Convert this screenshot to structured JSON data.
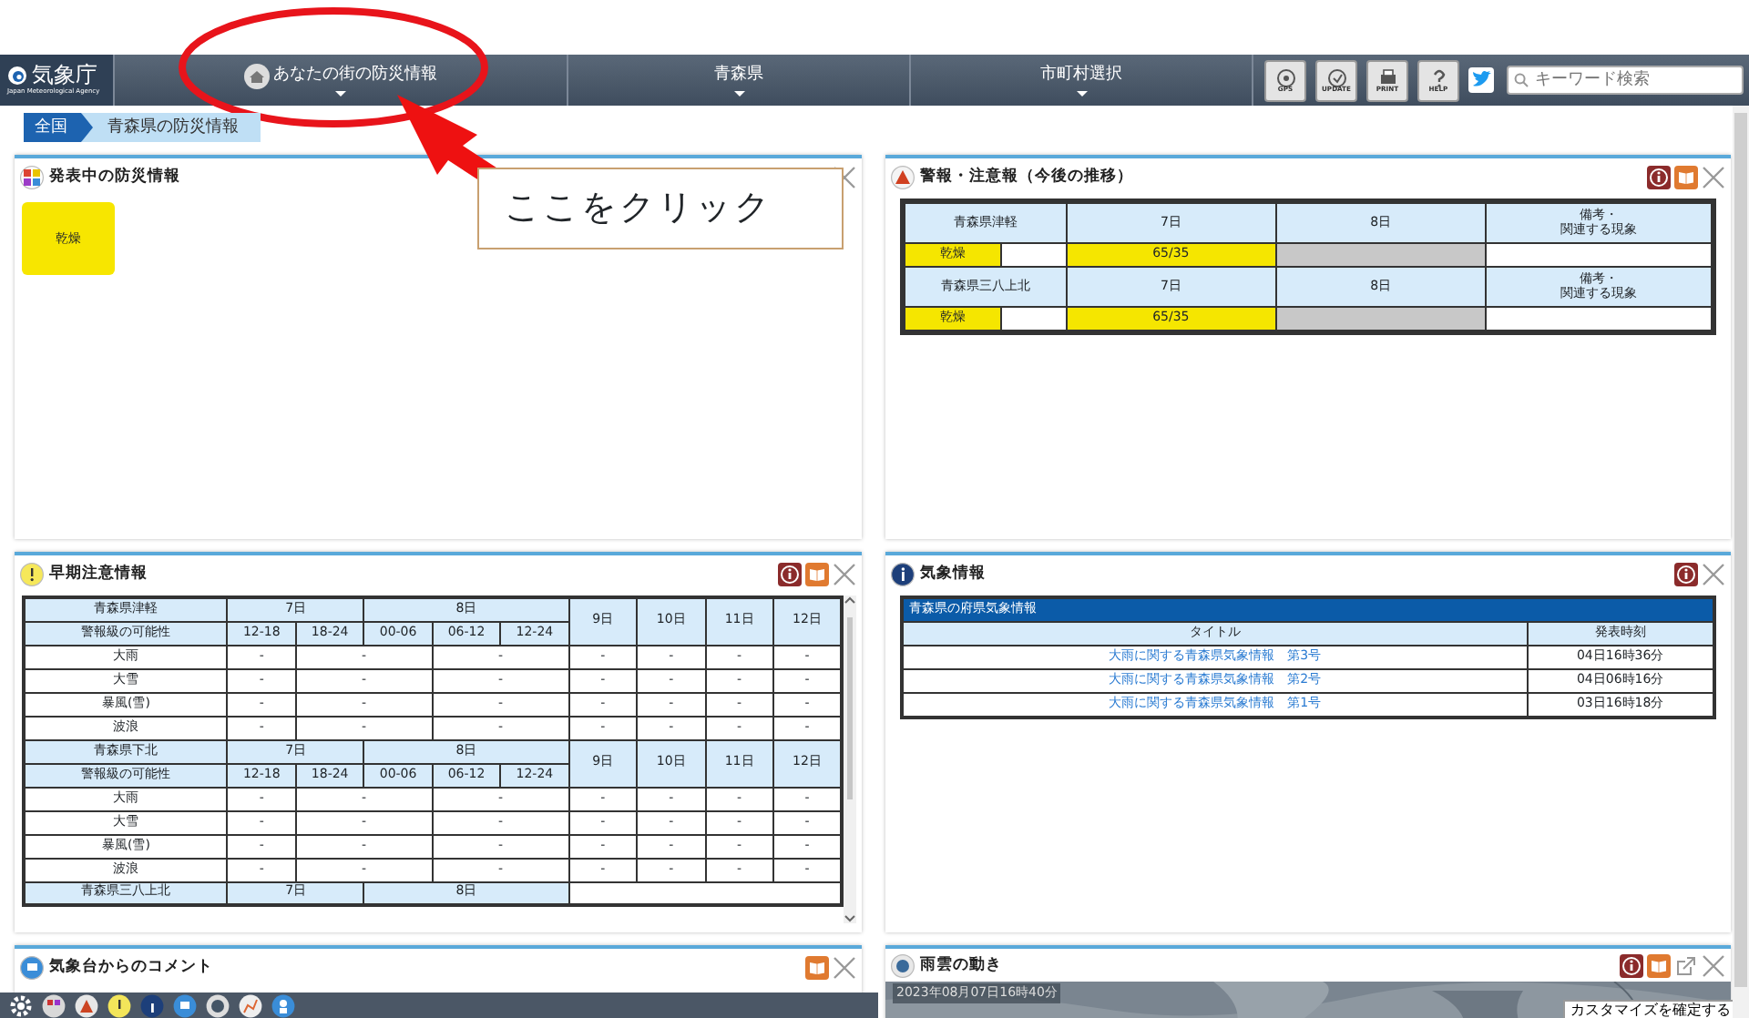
{
  "header": {
    "logo": {
      "name": "気象庁",
      "subtitle": "Japan Meteorological Agency"
    },
    "nav": [
      {
        "label": "あなたの街の防災情報",
        "kind": "home"
      },
      {
        "label": "青森県",
        "kind": "plain"
      },
      {
        "label": "市町村選択",
        "kind": "plain"
      }
    ],
    "tools": [
      {
        "label": "GPS",
        "kind": "gps"
      },
      {
        "label": "UPDATE",
        "kind": "update"
      },
      {
        "label": "PRINT",
        "kind": "print"
      },
      {
        "label": "HELP",
        "kind": "help"
      }
    ],
    "search": {
      "placeholder": "キーワード検索"
    }
  },
  "breadcrumb": [
    {
      "label": "全国",
      "selected": true
    },
    {
      "label": "青森県の防災情報",
      "selected": false
    }
  ],
  "active_info": {
    "title": "発表中の防災情報",
    "tiles": [
      "乾燥"
    ]
  },
  "annotation": {
    "callout": "ここをクリック"
  },
  "warnings": {
    "title": "警報・注意報（今後の推移）",
    "blocks": [
      {
        "area": "青森県津軽",
        "days": [
          "7日",
          "8日"
        ],
        "remarks": [
          "備考・",
          "関連する現象"
        ],
        "warning": "乾燥",
        "cells": [
          {
            "text": "65/35",
            "kind": "advisory"
          },
          {
            "kind": "none"
          }
        ]
      },
      {
        "area": "青森県三八上北",
        "days": [
          "7日",
          "8日"
        ],
        "remarks": [
          "備考・",
          "関連する現象"
        ],
        "warning": "乾燥",
        "cells": [
          {
            "text": "65/35",
            "kind": "advisory"
          },
          {
            "kind": "none"
          }
        ]
      }
    ]
  },
  "early_warnings": {
    "title": "早期注意情報",
    "blocks": [
      {
        "area": "青森県津軽",
        "days": [
          "7日",
          "8日"
        ],
        "subheader": "警報級の可能性",
        "periods": [
          "12-18",
          "18-24",
          "00-06",
          "06-12",
          "12-24"
        ],
        "later_days": [
          "9日",
          "10日",
          "11日",
          "12日"
        ],
        "rows": [
          {
            "phenomenon": "大雨",
            "values": [
              "-",
              "-",
              "-",
              "-",
              "-",
              "-",
              "-"
            ]
          },
          {
            "phenomenon": "大雪",
            "values": [
              "-",
              "-",
              "-",
              "-",
              "-",
              "-",
              "-"
            ]
          },
          {
            "phenomenon": "暴風(雪)",
            "values": [
              "-",
              "-",
              "-",
              "-",
              "-",
              "-",
              "-"
            ]
          },
          {
            "phenomenon": "波浪",
            "values": [
              "-",
              "-",
              "-",
              "-",
              "-",
              "-",
              "-"
            ]
          }
        ]
      },
      {
        "area": "青森県下北",
        "days": [
          "7日",
          "8日"
        ],
        "subheader": "警報級の可能性",
        "periods": [
          "12-18",
          "18-24",
          "00-06",
          "06-12",
          "12-24"
        ],
        "later_days": [
          "9日",
          "10日",
          "11日",
          "12日"
        ],
        "rows": [
          {
            "phenomenon": "大雨",
            "values": [
              "-",
              "-",
              "-",
              "-",
              "-",
              "-",
              "-"
            ]
          },
          {
            "phenomenon": "大雪",
            "values": [
              "-",
              "-",
              "-",
              "-",
              "-",
              "-",
              "-"
            ]
          },
          {
            "phenomenon": "暴風(雪)",
            "values": [
              "-",
              "-",
              "-",
              "-",
              "-",
              "-",
              "-"
            ]
          },
          {
            "phenomenon": "波浪",
            "values": [
              "-",
              "-",
              "-",
              "-",
              "-",
              "-",
              "-"
            ]
          }
        ]
      },
      {
        "area": "青森県三八上北",
        "days": [
          "7日",
          "8日"
        ]
      }
    ]
  },
  "weather_info": {
    "title": "気象情報",
    "section": "青森県の府県気象情報",
    "columns": [
      "タイトル",
      "発表時刻"
    ],
    "rows": [
      {
        "title": "大雨に関する青森県気象情報　第3号",
        "time": "04日16時36分"
      },
      {
        "title": "大雨に関する青森県気象情報　第2号",
        "time": "04日06時16分"
      },
      {
        "title": "大雨に関する青森県気象情報　第1号",
        "time": "03日16時18分"
      }
    ]
  },
  "comment": {
    "title": "気象台からのコメント"
  },
  "rain": {
    "title": "雨雲の動き",
    "timestamp": "2023年08月07日16時40分"
  },
  "confirm_button": "カスタマイズを確定する"
}
